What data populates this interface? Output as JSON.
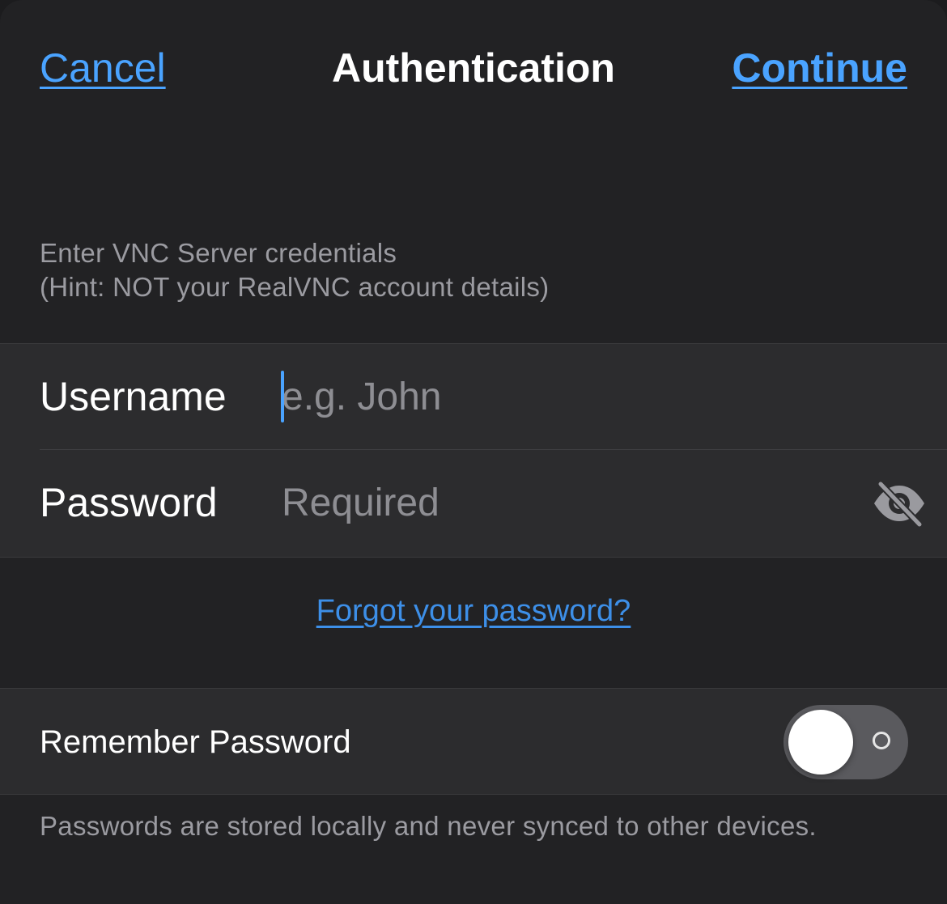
{
  "nav": {
    "cancel_label": "Cancel",
    "title": "Authentication",
    "continue_label": "Continue"
  },
  "credentials_section": {
    "header_line1": "Enter VNC Server credentials",
    "header_line2": "(Hint: NOT your RealVNC account details)"
  },
  "fields": {
    "username": {
      "label": "Username",
      "placeholder": "e.g. John",
      "value": ""
    },
    "password": {
      "label": "Password",
      "placeholder": "Required",
      "value": "",
      "visibility_icon": "eye-slash-icon"
    }
  },
  "forgot_link": "Forgot your password?",
  "remember": {
    "label": "Remember Password",
    "enabled": false
  },
  "footer_note": "Passwords are stored locally and never synced to other devices.",
  "colors": {
    "accent": "#4aa3ff",
    "link": "#3d8fe8",
    "background": "#222224",
    "group_background": "#2c2c2e",
    "secondary_text": "#9b9ba1"
  }
}
